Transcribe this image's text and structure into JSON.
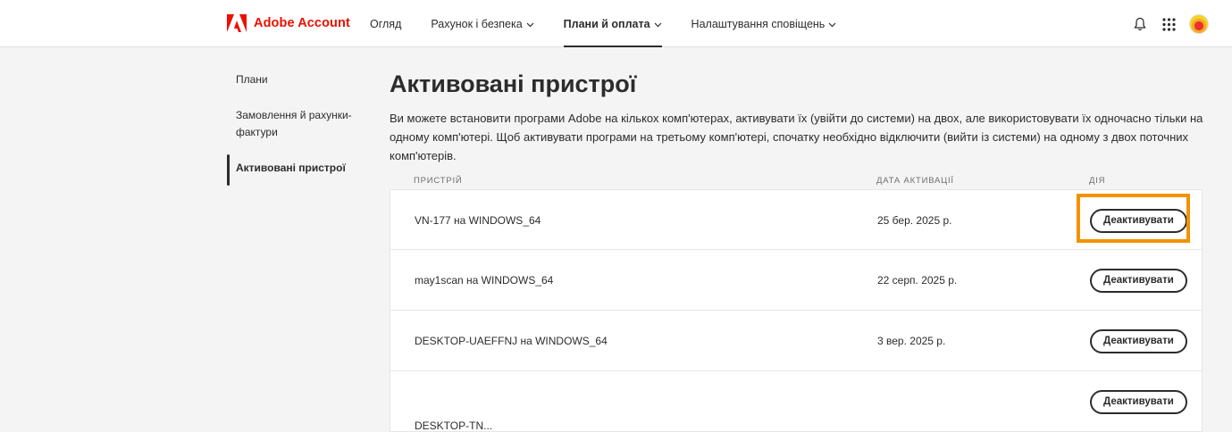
{
  "header": {
    "logo_text": "Adobe Account",
    "nav": [
      {
        "label": "Огляд",
        "dropdown": false,
        "active": false
      },
      {
        "label": "Рахунок і безпека",
        "dropdown": true,
        "active": false
      },
      {
        "label": "Плани й оплата",
        "dropdown": true,
        "active": true
      },
      {
        "label": "Налаштування сповіщень",
        "dropdown": true,
        "active": false
      }
    ],
    "icons": [
      "bell-icon",
      "apps-grid-icon",
      "avatar"
    ]
  },
  "sidebar": {
    "items": [
      {
        "label": "Плани",
        "active": false
      },
      {
        "label": "Замовлення й рахунки-фактури",
        "active": false
      },
      {
        "label": "Активовані пристрої",
        "active": true
      }
    ]
  },
  "main": {
    "title": "Активовані пристрої",
    "description": "Ви можете встановити програми Adobe на кількох комп'ютерах, активувати їх (увійти до системи) на двох, але використовувати їх одночасно тільки на одному комп'ютері. Щоб активувати програми на третьому комп'ютері, спочатку необхідно відключити (вийти із системи) на одному з двох поточних комп'ютерів.",
    "table": {
      "headers": {
        "device": "ПРИСТРІЙ",
        "date": "ДАТА АКТИВАЦІЇ",
        "action": "ДІЯ"
      },
      "rows": [
        {
          "device": "VN-177 на WINDOWS_64",
          "date": "25 бер. 2025 р.",
          "action": "Деактивувати"
        },
        {
          "device": "may1scan на WINDOWS_64",
          "date": "22 серп. 2025 р.",
          "action": "Деактивувати"
        },
        {
          "device": "DESKTOP-UAEFFNJ на WINDOWS_64",
          "date": "3 вер. 2025 р.",
          "action": "Деактивувати"
        },
        {
          "device": "DESKTOP-TN...",
          "date": "",
          "action": "Деактивувати"
        }
      ]
    }
  },
  "colors": {
    "brand": "#eb1000",
    "highlight": "#f39200",
    "text": "#2c2c2c",
    "background": "#f4f4f4"
  }
}
